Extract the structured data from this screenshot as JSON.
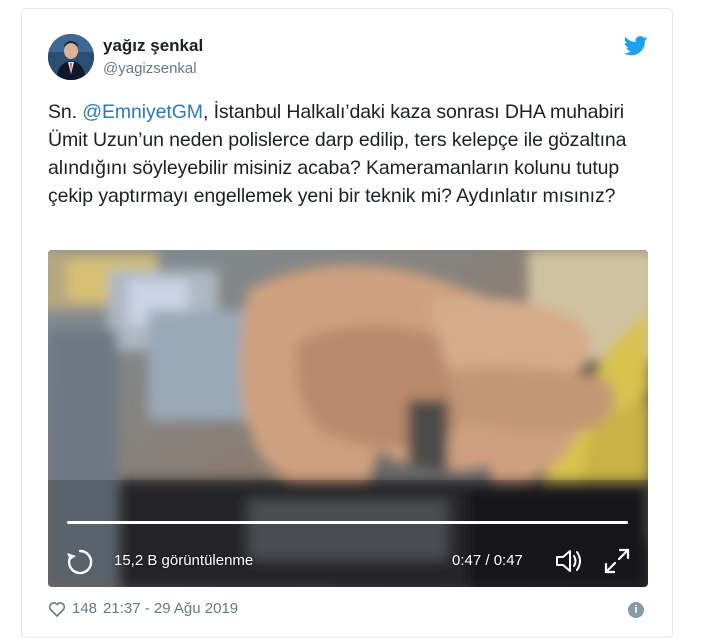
{
  "author": {
    "name": "yağız şenkal",
    "handle": "@yagizsenkal"
  },
  "tweet": {
    "prefix": "Sn. ",
    "mention": "@EmniyetGM",
    "body": ", İstanbul Halkalı’daki kaza sonrası DHA muhabiri Ümit Uzun’un neden polislerce darp edilip, ters kelepçe ile gözaltına alındığını söyleyebilir misiniz acaba? Kameramanların kolunu tutup çekip yaptırmayı engellemek yeni bir teknik mi? Aydınlatır mısınız?"
  },
  "video": {
    "views": "15,2 B görüntülenme",
    "time": "0:47 / 0:47",
    "progress_fraction": 1.0
  },
  "footer": {
    "likes": "148",
    "timestamp": "21:37 - 29 Ağu 2019"
  },
  "icons": {
    "brand": "twitter-bird-icon",
    "replay": "replay-icon",
    "volume": "volume-icon",
    "fullscreen": "fullscreen-icon",
    "like": "heart-icon",
    "info": "info-icon"
  },
  "colors": {
    "link": "#2b7bb9",
    "twitter_blue": "#1da1f2",
    "muted": "#697882"
  }
}
